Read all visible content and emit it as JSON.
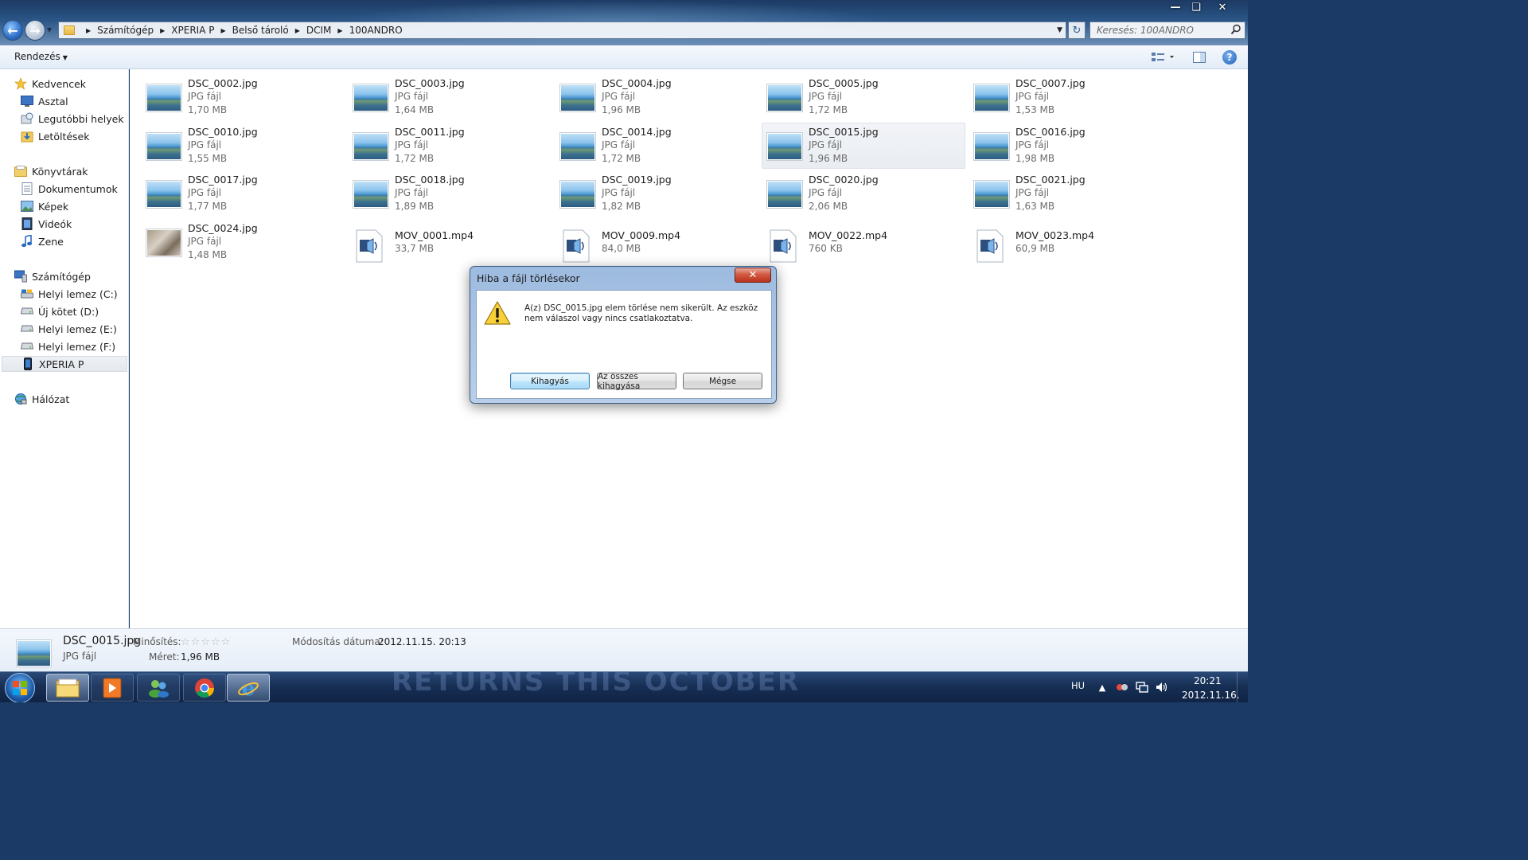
{
  "window": {
    "breadcrumbs": [
      "Számítógép",
      "XPERIA P",
      "Belső tároló",
      "DCIM",
      "100ANDRO"
    ],
    "search_placeholder": "Keresés: 100ANDRO"
  },
  "toolbar": {
    "organize_label": "Rendezés"
  },
  "nav": {
    "favorites": {
      "label": "Kedvencek",
      "items": [
        "Asztal",
        "Legutóbbi helyek",
        "Letöltések"
      ]
    },
    "libraries": {
      "label": "Könyvtárak",
      "items": [
        "Dokumentumok",
        "Képek",
        "Videók",
        "Zene"
      ]
    },
    "computer": {
      "label": "Számítógép",
      "items": [
        "Helyi lemez (C:)",
        "Új kötet (D:)",
        "Helyi lemez (E:)",
        "Helyi lemez (F:)",
        "XPERIA P"
      ]
    },
    "network": {
      "label": "Hálózat"
    }
  },
  "files": [
    {
      "name": "DSC_0002.jpg",
      "type": "JPG fájl",
      "size": "1,70 MB"
    },
    {
      "name": "DSC_0003.jpg",
      "type": "JPG fájl",
      "size": "1,64 MB"
    },
    {
      "name": "DSC_0004.jpg",
      "type": "JPG fájl",
      "size": "1,96 MB"
    },
    {
      "name": "DSC_0005.jpg",
      "type": "JPG fájl",
      "size": "1,72 MB"
    },
    {
      "name": "DSC_0007.jpg",
      "type": "JPG fájl",
      "size": "1,53 MB"
    },
    {
      "name": "DSC_0010.jpg",
      "type": "JPG fájl",
      "size": "1,55 MB"
    },
    {
      "name": "DSC_0011.jpg",
      "type": "JPG fájl",
      "size": "1,72 MB"
    },
    {
      "name": "DSC_0014.jpg",
      "type": "JPG fájl",
      "size": "1,72 MB"
    },
    {
      "name": "DSC_0015.jpg",
      "type": "JPG fájl",
      "size": "1,96 MB"
    },
    {
      "name": "DSC_0016.jpg",
      "type": "JPG fájl",
      "size": "1,98 MB"
    },
    {
      "name": "DSC_0017.jpg",
      "type": "JPG fájl",
      "size": "1,77 MB"
    },
    {
      "name": "DSC_0018.jpg",
      "type": "JPG fájl",
      "size": "1,89 MB"
    },
    {
      "name": "DSC_0019.jpg",
      "type": "JPG fájl",
      "size": "1,82 MB"
    },
    {
      "name": "DSC_0020.jpg",
      "type": "JPG fájl",
      "size": "2,06 MB"
    },
    {
      "name": "DSC_0021.jpg",
      "type": "JPG fájl",
      "size": "1,63 MB"
    },
    {
      "name": "DSC_0024.jpg",
      "type": "JPG fájl",
      "size": "1,48 MB"
    },
    {
      "name": "MOV_0001.mp4",
      "size": "33,7 MB"
    },
    {
      "name": "MOV_0009.mp4",
      "size": "84,0 MB"
    },
    {
      "name": "MOV_0022.mp4",
      "size": "760 KB"
    },
    {
      "name": "MOV_0023.mp4",
      "size": "60,9 MB"
    }
  ],
  "details": {
    "name": "DSC_0015.jpg",
    "type": "JPG fájl",
    "rating_label": "Minősítés:",
    "rating": 0,
    "modified_label": "Módosítás dátuma:",
    "modified_value": "2012.11.15. 20:13",
    "size_label": "Méret:",
    "size_value": "1,96 MB"
  },
  "dialog": {
    "title": "Hiba a fájl törlésekor",
    "message": "A(z) DSC_0015.jpg elem törlése nem sikerült. Az eszköz nem válaszol vagy nincs csatlakoztatva.",
    "buttons": {
      "skip": "Kihagyás",
      "skip_all": "Az összes kihagyása",
      "cancel": "Mégse"
    }
  },
  "taskbar": {
    "language": "HU",
    "time": "20:21",
    "date": "2012.11.16.",
    "wallpaper_text": "RETURNS THIS OCTOBER"
  },
  "colors": {
    "accent": "#2d6dc4",
    "close_red": "#c8432c",
    "selection": "#e9edf2"
  }
}
